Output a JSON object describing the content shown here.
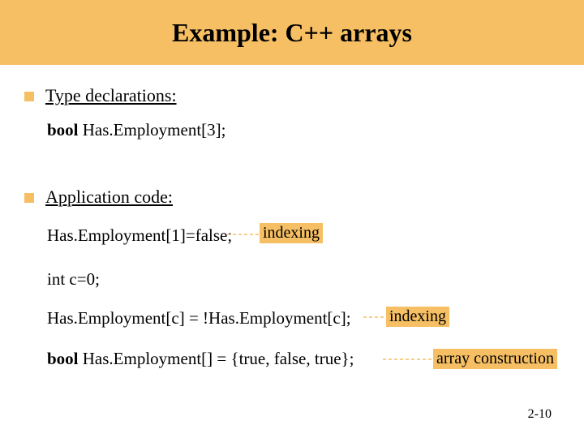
{
  "title": "Example: C++ arrays",
  "bullets": {
    "type_decl": "Type declarations:",
    "app_code": "Application code:"
  },
  "code": {
    "decl": "bool Has.Employment[3];",
    "assign": "Has.Employment[1]=false;",
    "intc": "int c=0;",
    "negate": "Has.Employment[c] = !Has.Employment[c];",
    "init": "bool Has.Employment[] = {true, false, true};"
  },
  "badges": {
    "indexing": "indexing",
    "array_construction": "array construction"
  },
  "slide_number": "2-10"
}
